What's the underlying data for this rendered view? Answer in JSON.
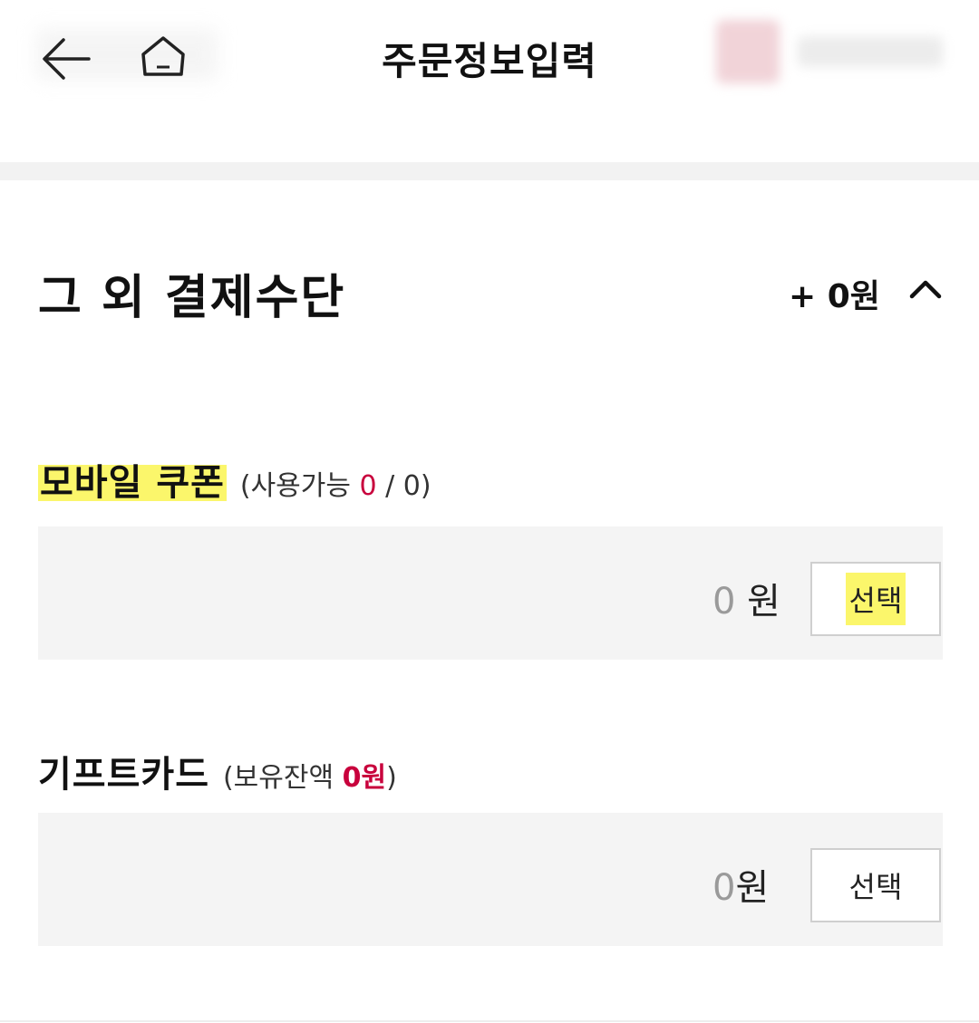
{
  "header": {
    "title": "주문정보입력",
    "back_icon": "arrow-left-icon",
    "home_icon": "home-icon"
  },
  "section": {
    "title": "그 외 결제수단",
    "total": "+ 0원",
    "toggle_icon": "chevron-up-icon"
  },
  "mobile_coupon": {
    "label": "모바일 쿠폰",
    "sub_prefix": "(사용가능 ",
    "available": "0",
    "sub_sep": " / ",
    "total": "0",
    "sub_suffix": ")",
    "amount": "0",
    "currency": " 원",
    "button": "선택"
  },
  "gift_card": {
    "label": "기프트카드",
    "sub_prefix": "(보유잔액 ",
    "balance": "0원",
    "sub_suffix": ")",
    "amount": "0",
    "currency": "원",
    "button": "선택"
  },
  "colors": {
    "accent": "#c8003c",
    "highlight": "#fbf66b",
    "panel": "#f4f4f4"
  }
}
